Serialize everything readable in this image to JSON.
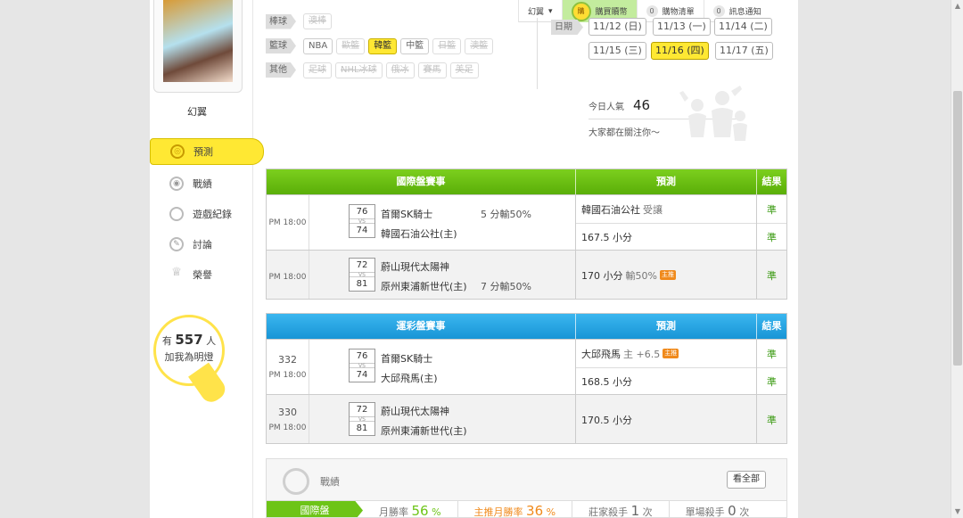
{
  "topbar": {
    "user": "幻翼",
    "buy": "購買贖幣",
    "buy_badge": "購",
    "cart_count": "0",
    "cart_label": "購物清單",
    "msg_count": "0",
    "msg_label": "訊息通知"
  },
  "sidebar": {
    "username": "幻翼",
    "items": [
      {
        "label": "預測",
        "icon": "target-icon",
        "active": true
      },
      {
        "label": "戰績",
        "icon": "record-icon"
      },
      {
        "label": "遊戲紀錄",
        "icon": "circle-icon"
      },
      {
        "label": "討論",
        "icon": "discuss-icon"
      },
      {
        "label": "榮譽",
        "icon": "honor-icon"
      }
    ],
    "bulb": {
      "prefix": "有",
      "count": "557",
      "suffix": "人",
      "line2": "加我為明燈"
    }
  },
  "filters": {
    "rows": [
      {
        "label": "棒球",
        "chips": [
          {
            "text": "澳棒",
            "state": "disabled"
          }
        ]
      },
      {
        "label": "籃球",
        "chips": [
          {
            "text": "NBA",
            "state": "normal"
          },
          {
            "text": "歐籃",
            "state": "disabled"
          },
          {
            "text": "韓籃",
            "state": "active"
          },
          {
            "text": "中籃",
            "state": "normal"
          },
          {
            "text": "日籃",
            "state": "disabled"
          },
          {
            "text": "澳籃",
            "state": "disabled"
          }
        ]
      },
      {
        "label": "其他",
        "chips": [
          {
            "text": "足球",
            "state": "disabled"
          },
          {
            "text": "NHL冰球",
            "state": "disabled"
          },
          {
            "text": "俄冰",
            "state": "disabled"
          },
          {
            "text": "賽馬",
            "state": "disabled"
          },
          {
            "text": "美足",
            "state": "disabled"
          }
        ]
      }
    ]
  },
  "dates": {
    "label": "日期",
    "items": [
      "11/12 (日)",
      "11/13 (一)",
      "11/14 (二)",
      "11/15 (三)",
      "11/16 (四)",
      "11/17 (五)"
    ],
    "active": "11/16 (四)"
  },
  "popularity": {
    "label": "今日人氣",
    "count": "46",
    "subtitle": "大家都在關注你～"
  },
  "international": {
    "headers": [
      "國際盤賽事",
      "預測",
      "結果"
    ],
    "games": [
      {
        "time": "PM 18:00",
        "score_top": "76",
        "score_bottom": "74",
        "team_top": "首爾SK騎士",
        "team_bottom": "韓國石油公社(主)",
        "spread": "5 分輸50%",
        "predictions": [
          {
            "main": "韓國石油公社",
            "muted": "受讓",
            "tag": ""
          },
          {
            "main": "167.5 小分",
            "muted": "",
            "tag": ""
          }
        ],
        "results": [
          "準",
          "準"
        ]
      },
      {
        "time": "PM 18:00",
        "score_top": "72",
        "score_bottom": "81",
        "team_top": "蔚山現代太陽神",
        "team_bottom": "原州東浦新世代(主)",
        "spread": "7 分輸50%",
        "predictions": [
          {
            "main": "170 小分",
            "muted": "輸50%",
            "tag": "主推"
          }
        ],
        "results": [
          "準"
        ]
      }
    ]
  },
  "lottery": {
    "headers": [
      "運彩盤賽事",
      "預測",
      "結果"
    ],
    "games": [
      {
        "num": "332",
        "time": "PM 18:00",
        "score_top": "76",
        "score_bottom": "74",
        "team_top": "首爾SK騎士",
        "team_bottom": "大邱飛馬(主)",
        "predictions": [
          {
            "main": "大邱飛馬",
            "muted": "主 +6.5",
            "tag": "主推"
          },
          {
            "main": "168.5 小分",
            "muted": "",
            "tag": ""
          }
        ],
        "results": [
          "準",
          "準"
        ]
      },
      {
        "num": "330",
        "time": "PM 18:00",
        "score_top": "72",
        "score_bottom": "81",
        "team_top": "蔚山現代太陽神",
        "team_bottom": "原州東浦新世代(主)",
        "predictions": [
          {
            "main": "170.5 小分",
            "muted": "",
            "tag": ""
          }
        ],
        "results": [
          "準"
        ]
      }
    ]
  },
  "record": {
    "title": "戰績",
    "button": "看全部",
    "tab": "國際盤",
    "stats": [
      {
        "label": "月勝率",
        "value": "56",
        "unit": "%",
        "color": "green"
      },
      {
        "label": "主推月勝率",
        "value": "36",
        "unit": "%",
        "color": "orange"
      },
      {
        "label": "莊家殺手",
        "value": "1",
        "unit": "次",
        "color": "dark"
      },
      {
        "label": "單場殺手",
        "value": "0",
        "unit": "次",
        "color": "dark"
      }
    ]
  },
  "colors": {
    "accent_green": "#6dc417",
    "accent_yellow": "#ffe833",
    "blue_header": "#1895d6",
    "tag_orange": "#f08a1c"
  }
}
